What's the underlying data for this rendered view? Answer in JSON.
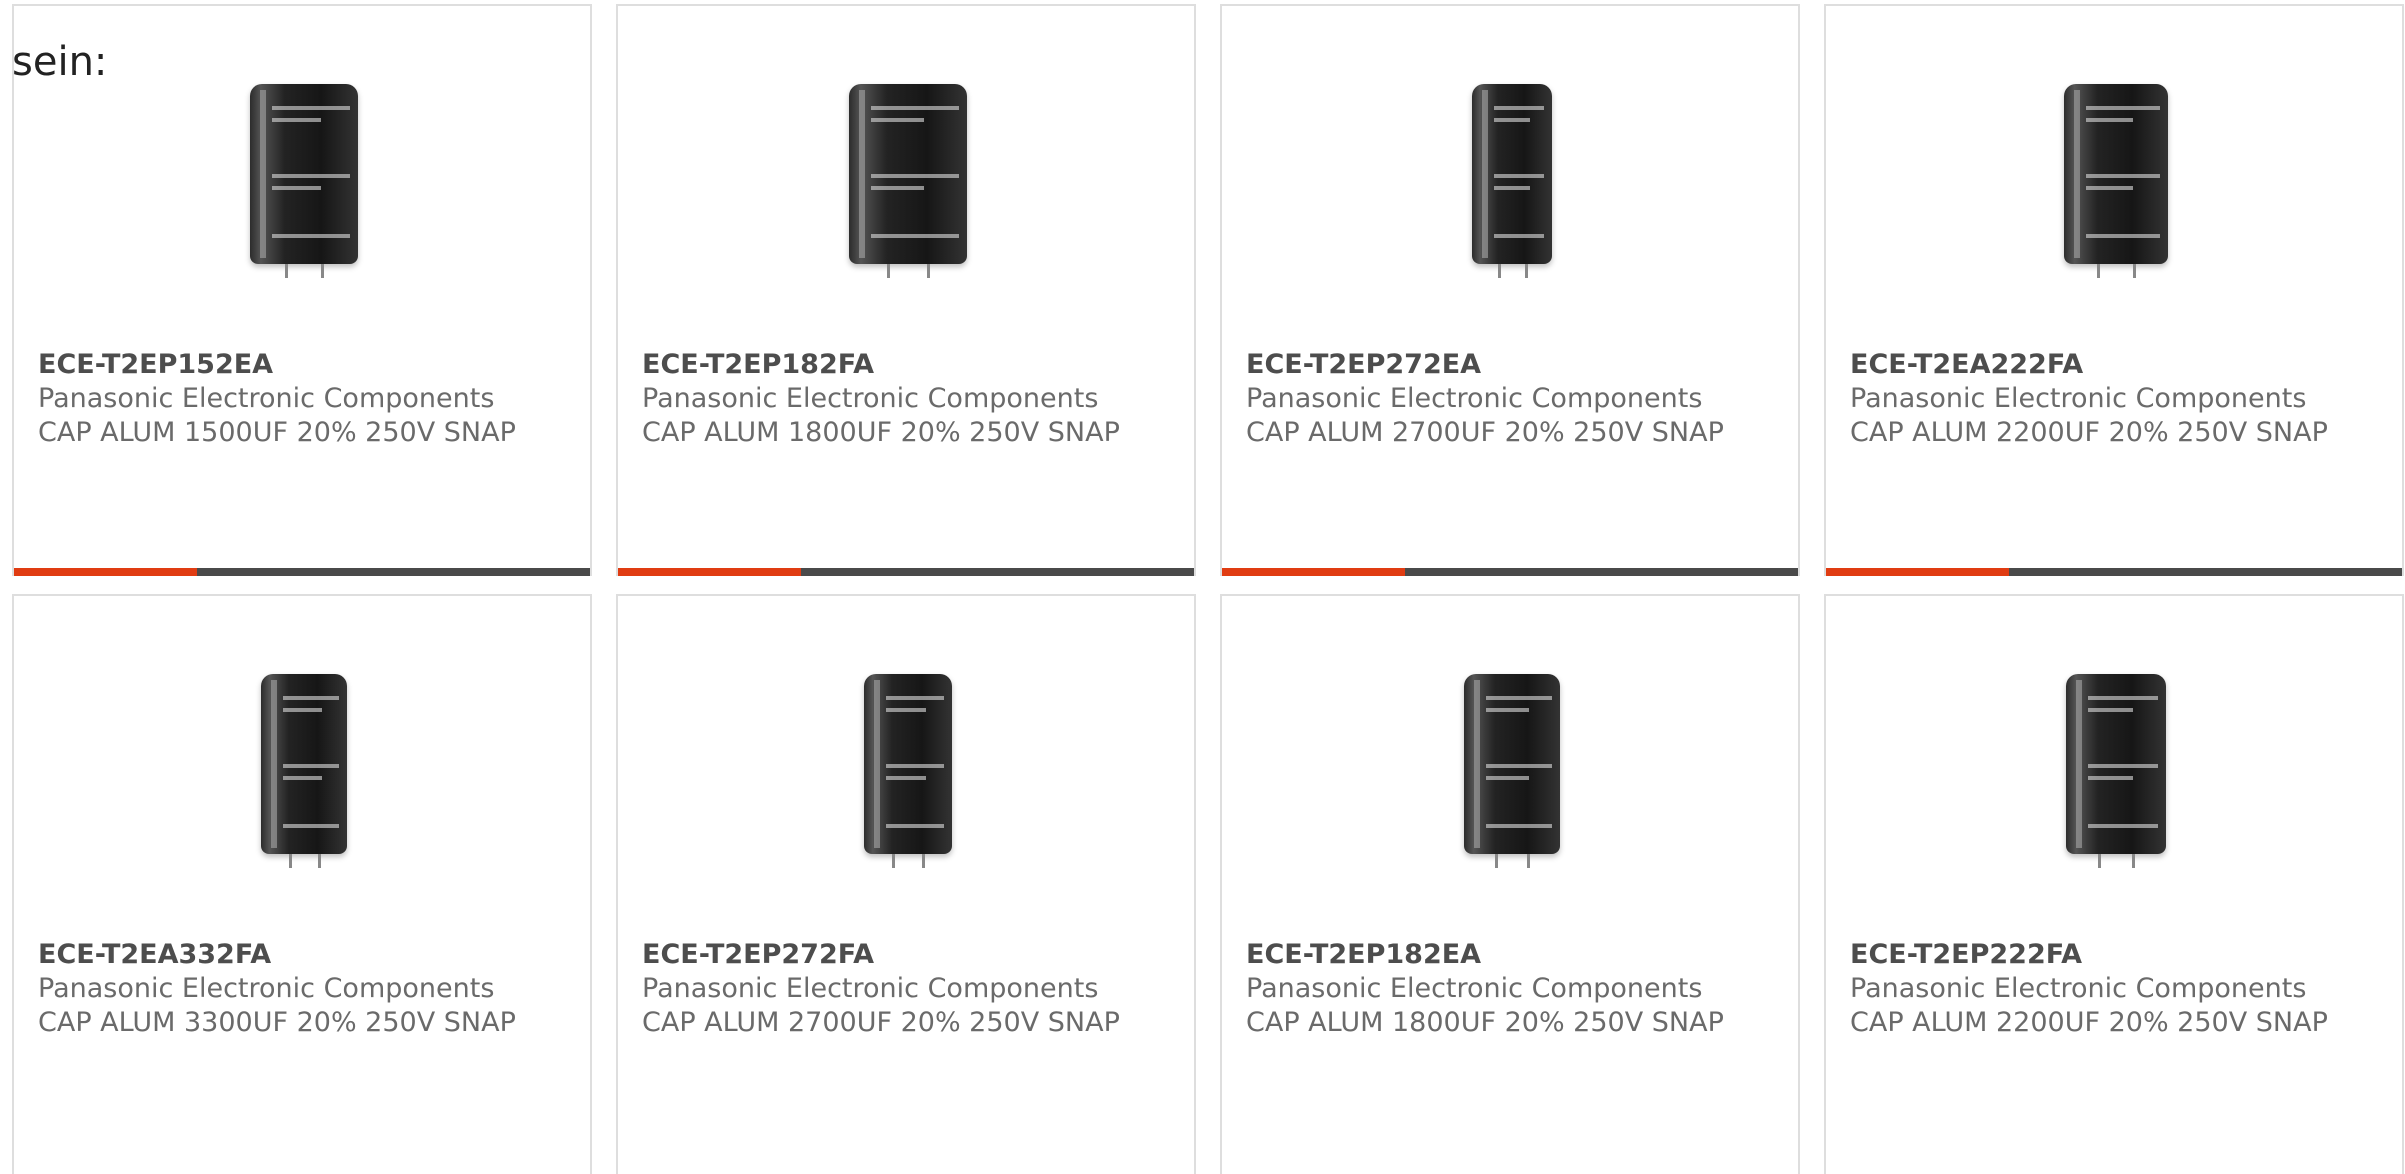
{
  "intro_text": "sein:",
  "products": [
    {
      "part_number": "ECE-T2EP152EA",
      "manufacturer": "Panasonic Electronic Components",
      "description": "CAP ALUM 1500UF 20% 250V SNAP",
      "image_icon": "capacitor-image"
    },
    {
      "part_number": "ECE-T2EP182FA",
      "manufacturer": "Panasonic Electronic Components",
      "description": "CAP ALUM 1800UF 20% 250V SNAP",
      "image_icon": "capacitor-image"
    },
    {
      "part_number": "ECE-T2EP272EA",
      "manufacturer": "Panasonic Electronic Components",
      "description": "CAP ALUM 2700UF 20% 250V SNAP",
      "image_icon": "capacitor-image"
    },
    {
      "part_number": "ECE-T2EA222FA",
      "manufacturer": "Panasonic Electronic Components",
      "description": "CAP ALUM 2200UF 20% 250V SNAP",
      "image_icon": "capacitor-image"
    },
    {
      "part_number": "ECE-T2EA332FA",
      "manufacturer": "Panasonic Electronic Components",
      "description": "CAP ALUM 3300UF 20% 250V SNAP",
      "image_icon": "capacitor-image"
    },
    {
      "part_number": "ECE-T2EP272FA",
      "manufacturer": "Panasonic Electronic Components",
      "description": "CAP ALUM 2700UF 20% 250V SNAP",
      "image_icon": "capacitor-image"
    },
    {
      "part_number": "ECE-T2EP182EA",
      "manufacturer": "Panasonic Electronic Components",
      "description": "CAP ALUM 1800UF 20% 250V SNAP",
      "image_icon": "capacitor-image"
    },
    {
      "part_number": "ECE-T2EP222FA",
      "manufacturer": "Panasonic Electronic Components",
      "description": "CAP ALUM 2200UF 20% 250V SNAP",
      "image_icon": "capacitor-image"
    }
  ],
  "colors": {
    "accent": "#e03c12",
    "bar": "#4a4a4a",
    "border": "#dedede"
  }
}
